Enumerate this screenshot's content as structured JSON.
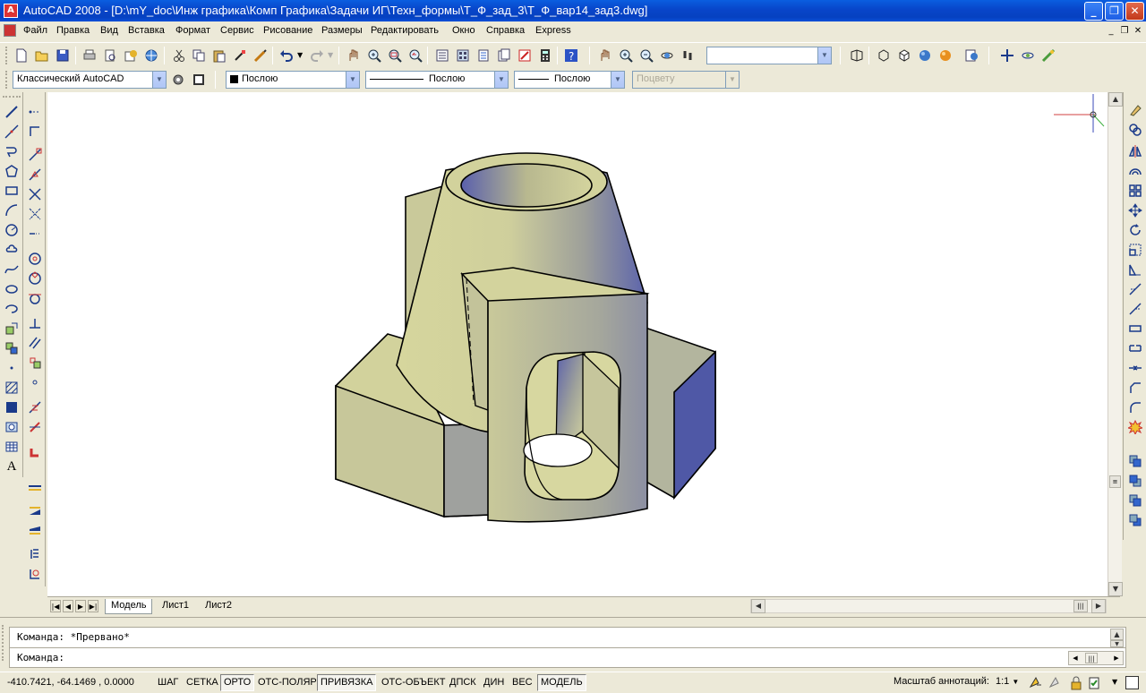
{
  "window": {
    "title": "AutoCAD 2008 - [D:\\mY_doc\\Инж графика\\Комп Графика\\Задачи ИГ\\Техн_формы\\Т_Ф_зад_3\\Т_Ф_вар14_зад3.dwg]",
    "minimize": "_",
    "maximize": "❐",
    "close": "✕"
  },
  "menu": {
    "items": [
      "Файл",
      "Правка",
      "Вид",
      "Вставка",
      "Формат",
      "Сервис",
      "Рисование",
      "Размеры",
      "Редактировать",
      "Окно",
      "Справка",
      "Express"
    ],
    "doc_controls": [
      "_",
      "❐",
      "✕"
    ]
  },
  "toolbars": {
    "workspace": "Классический AutoCAD",
    "layer_color": "Послою",
    "linetype": "Послою",
    "lineweight": "Послою",
    "plotstyle": "Поцвету",
    "named_view": ""
  },
  "tabs": [
    "Модель",
    "Лист1",
    "Лист2"
  ],
  "command": {
    "history": "Команда: *Прервано*",
    "prompt": "Команда:"
  },
  "status": {
    "coords": "-410.7421, -64.1469 , 0.0000",
    "buttons": [
      {
        "label": "ШАГ",
        "on": false
      },
      {
        "label": "СЕТКА",
        "on": false
      },
      {
        "label": "ОРТО",
        "on": true
      },
      {
        "label": "ОТС-ПОЛЯР",
        "on": false
      },
      {
        "label": "ПРИВЯЗКА",
        "on": true
      },
      {
        "label": "ОТС-ОБЪЕКТ",
        "on": false
      },
      {
        "label": "ДПСК",
        "on": false
      },
      {
        "label": "ДИН",
        "on": false
      },
      {
        "label": "ВЕС",
        "on": false
      },
      {
        "label": "МОДЕЛЬ",
        "on": true
      }
    ],
    "annotation_scale_label": "Масштаб аннотаций:",
    "annotation_scale": "1:1"
  },
  "colors": {
    "model_face_light": "#d5d59a",
    "model_face_mid": "#b8b88c",
    "model_face_dark": "#5862a6",
    "titlebar": "#0845c9"
  }
}
